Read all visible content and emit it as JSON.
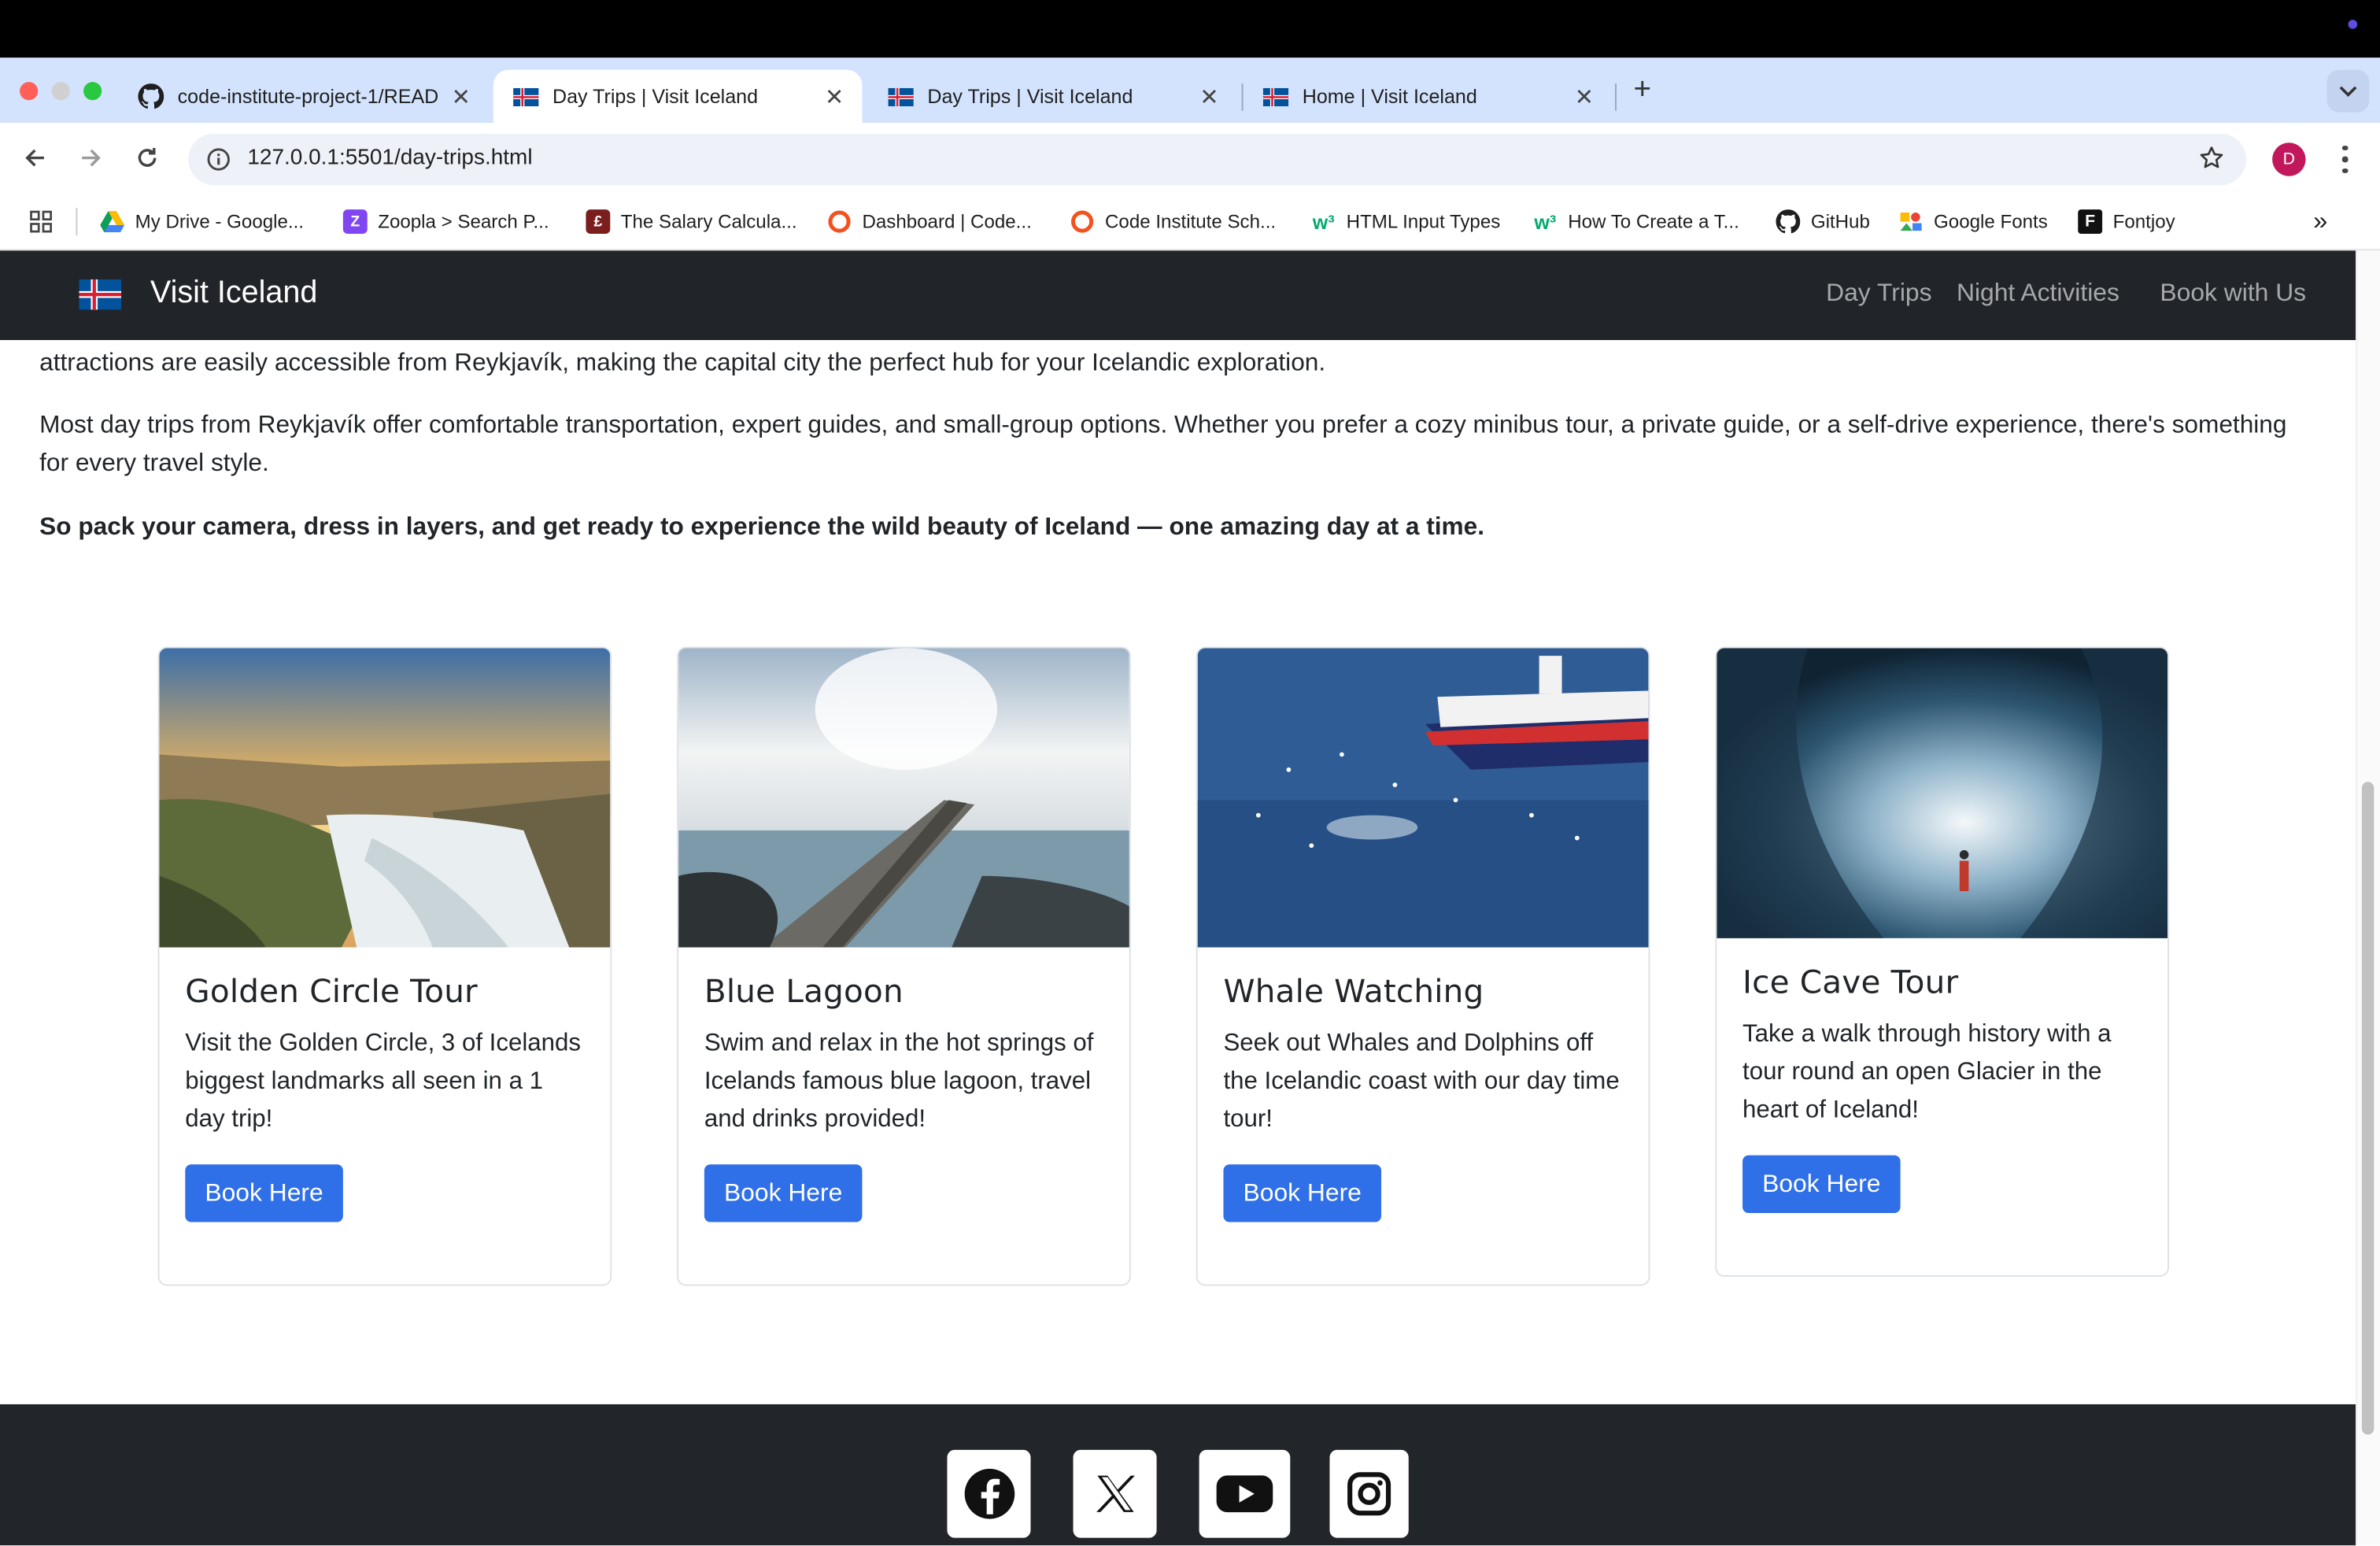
{
  "browser": {
    "tabs": [
      {
        "title": "code-institute-project-1/READ",
        "icon": "github-icon",
        "active": false
      },
      {
        "title": "Day Trips | Visit Iceland",
        "icon": "iceland-flag-icon",
        "active": true
      },
      {
        "title": "Day Trips | Visit Iceland",
        "icon": "iceland-flag-icon",
        "active": false
      },
      {
        "title": "Home | Visit Iceland",
        "icon": "iceland-flag-icon",
        "active": false
      }
    ],
    "new_tab": "+",
    "url": "127.0.0.1:5501/day-trips.html",
    "profile_initial": "D",
    "bookmarks": [
      {
        "label": "My Drive - Google...",
        "icon": "google-drive-icon"
      },
      {
        "label": "Zoopla > Search P...",
        "icon": "zoopla-icon"
      },
      {
        "label": "The Salary Calcula...",
        "icon": "salary-calculator-icon"
      },
      {
        "label": "Dashboard | Code...",
        "icon": "code-institute-icon"
      },
      {
        "label": "Code Institute Sch...",
        "icon": "code-institute-icon"
      },
      {
        "label": "HTML Input Types",
        "icon": "w3schools-icon"
      },
      {
        "label": "How To Create a T...",
        "icon": "w3schools-icon"
      },
      {
        "label": "GitHub",
        "icon": "github-icon"
      },
      {
        "label": "Google Fonts",
        "icon": "google-fonts-icon"
      },
      {
        "label": "Fontjoy",
        "icon": "fontjoy-icon"
      }
    ],
    "bookmarks_overflow": "»"
  },
  "site": {
    "brand": "Visit Iceland",
    "nav": [
      "Day Trips",
      "Night Activities",
      "Book with Us"
    ]
  },
  "intro": {
    "p1": "attractions are easily accessible from Reykjavík, making the capital city the perfect hub for your Icelandic exploration.",
    "p2": "Most day trips from Reykjavík offer comfortable transportation, expert guides, and small-group options. Whether you prefer a cozy minibus tour, a private guide, or a self-drive experience, there's something for every travel style.",
    "p3": "So pack your camera, dress in layers, and get ready to experience the wild beauty of Iceland — one amazing day at a time."
  },
  "cards": [
    {
      "title": "Golden Circle Tour",
      "text": "Visit the Golden Circle, 3 of Icelands biggest landmarks all seen in a 1 day trip!",
      "button": "Book Here"
    },
    {
      "title": "Blue Lagoon",
      "text": "Swim and relax in the hot springs of Icelands famous blue lagoon, travel and drinks provided!",
      "button": "Book Here"
    },
    {
      "title": "Whale Watching",
      "text": "Seek out Whales and Dolphins off the Icelandic coast with our day time tour!",
      "button": "Book Here"
    },
    {
      "title": "Ice Cave Tour",
      "text": "Take a walk through history with a tour round an open Glacier in the heart of Iceland!",
      "button": "Book Here"
    }
  ],
  "footer": {
    "social": [
      "facebook-icon",
      "x-icon",
      "youtube-icon",
      "instagram-icon"
    ]
  },
  "colors": {
    "navbar_bg": "#212529",
    "button_blue": "#2f6fe8",
    "footer_bg": "#222529",
    "tabstrip_bg": "#d3e3fd"
  }
}
